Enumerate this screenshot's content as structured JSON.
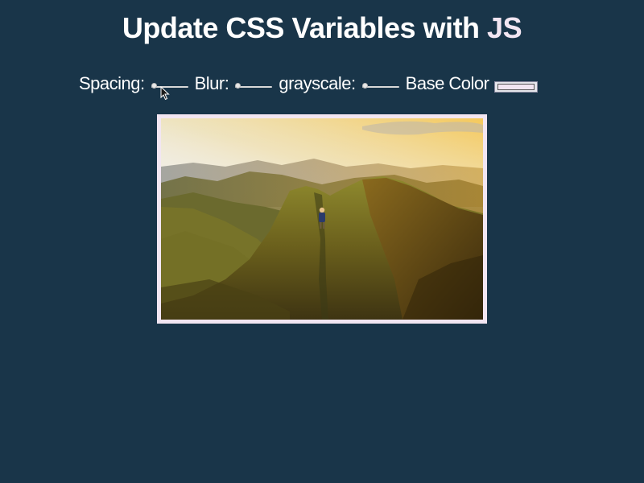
{
  "header": {
    "title_main": "Update CSS Variables with ",
    "title_highlight": "JS"
  },
  "controls": {
    "spacing": {
      "label": "Spacing:",
      "value": 0
    },
    "blur": {
      "label": "Blur:",
      "value": 0
    },
    "grayscale": {
      "label": "grayscale:",
      "value": 0
    },
    "base_color": {
      "label": "Base Color",
      "value": "#f2e6f2"
    }
  },
  "image": {
    "icon": "mountain-hiker-photo"
  },
  "colors": {
    "background": "#193549",
    "base": "#f2e6f2"
  }
}
